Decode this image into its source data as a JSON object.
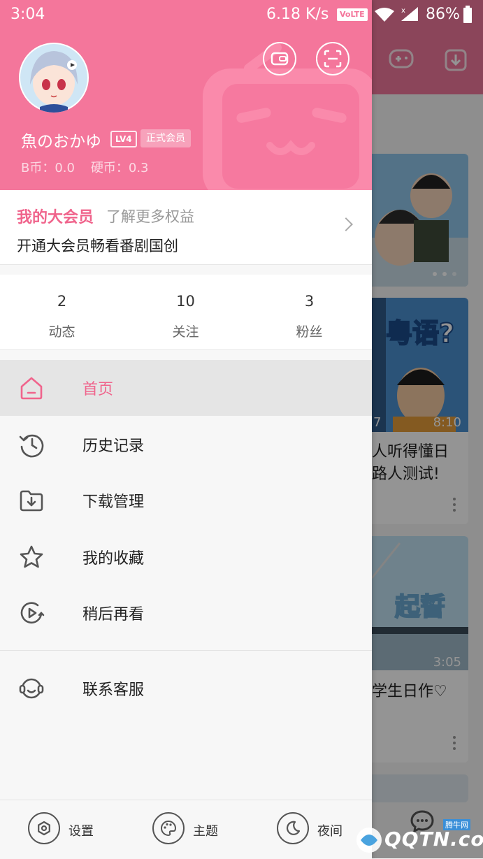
{
  "status_bar": {
    "time": "3:04",
    "speed": "6.18 K/s",
    "volte": "VoLTE",
    "battery": "86%"
  },
  "profile": {
    "username": "魚のおかゆ",
    "level": "LV4",
    "member_badge": "正式会员",
    "coins": "B币：0.0    硬币：0.3"
  },
  "vip": {
    "title": "我的大会员",
    "more": "了解更多权益",
    "desc": "开通大会员畅看番剧国创"
  },
  "stats": [
    {
      "num": "2",
      "label": "动态"
    },
    {
      "num": "10",
      "label": "关注"
    },
    {
      "num": "3",
      "label": "粉丝"
    }
  ],
  "menu": [
    {
      "label": "首页",
      "icon": "home-icon",
      "active": true
    },
    {
      "label": "历史记录",
      "icon": "history-icon"
    },
    {
      "label": "下载管理",
      "icon": "download-folder-icon"
    },
    {
      "label": "我的收藏",
      "icon": "star-icon"
    },
    {
      "label": "稍后再看",
      "icon": "watch-later-icon"
    },
    {
      "label": "联系客服",
      "icon": "headset-icon"
    }
  ],
  "footer": {
    "settings": "设置",
    "theme": "主题",
    "night": "夜间"
  },
  "background_cards": {
    "card2": {
      "thumb_text": "粤语?",
      "duration": "8:10",
      "left_num": "7",
      "title_line1": "人听得懂日",
      "title_line2": "路人测试!"
    },
    "card3": {
      "thumb_text": "起誓",
      "duration": "3:05",
      "title_line1": "学生日作♡"
    }
  },
  "watermark": {
    "text": "QQTN.com",
    "tag": "腾牛网"
  },
  "colors": {
    "accent": "#f4769b",
    "pink_text": "#f0648c"
  }
}
